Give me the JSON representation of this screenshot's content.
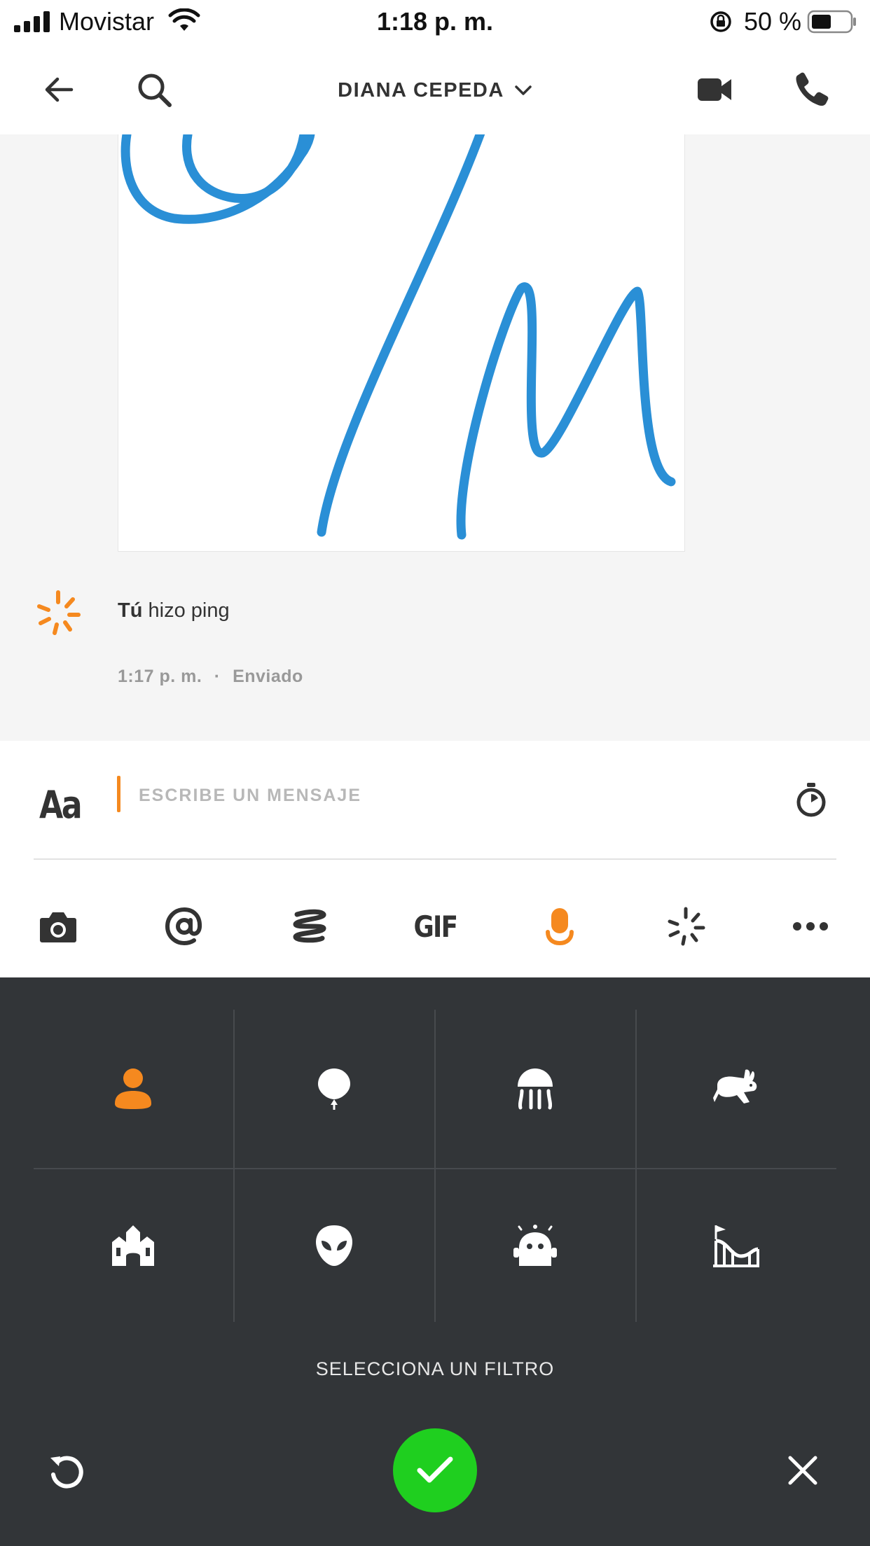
{
  "status_bar": {
    "carrier": "Movistar",
    "time": "1:18 p. m.",
    "battery": "50 %"
  },
  "header": {
    "title": "DIANA CEPEDA"
  },
  "conversation": {
    "ping": {
      "sender": "Tú",
      "action": "hizo ping"
    },
    "timestamp": "1:17 p. m.",
    "separator": "·",
    "status": "Enviado"
  },
  "composer": {
    "format_label": "Aa",
    "placeholder": "ESCRIBE UN MENSAJE",
    "tools": [
      "camera-icon",
      "mention-icon",
      "sketch-icon",
      "gif",
      "voice-filter-icon",
      "ping-icon",
      "more-icon"
    ],
    "gif_label": "GIF",
    "active_tool": "voice-filter-icon"
  },
  "filter_panel": {
    "filters": [
      "person-icon",
      "balloon-icon",
      "jellyfish-icon",
      "rabbit-icon",
      "cathedral-icon",
      "alien-icon",
      "robot-icon",
      "rollercoaster-icon"
    ],
    "selected_filter": "person-icon",
    "prompt": "SELECCIONA UN FILTRO"
  },
  "colors": {
    "accent": "#f5891f",
    "sketch_stroke": "#2a8fd6",
    "panel_bg": "#323538",
    "confirm": "#1fcf1f"
  }
}
